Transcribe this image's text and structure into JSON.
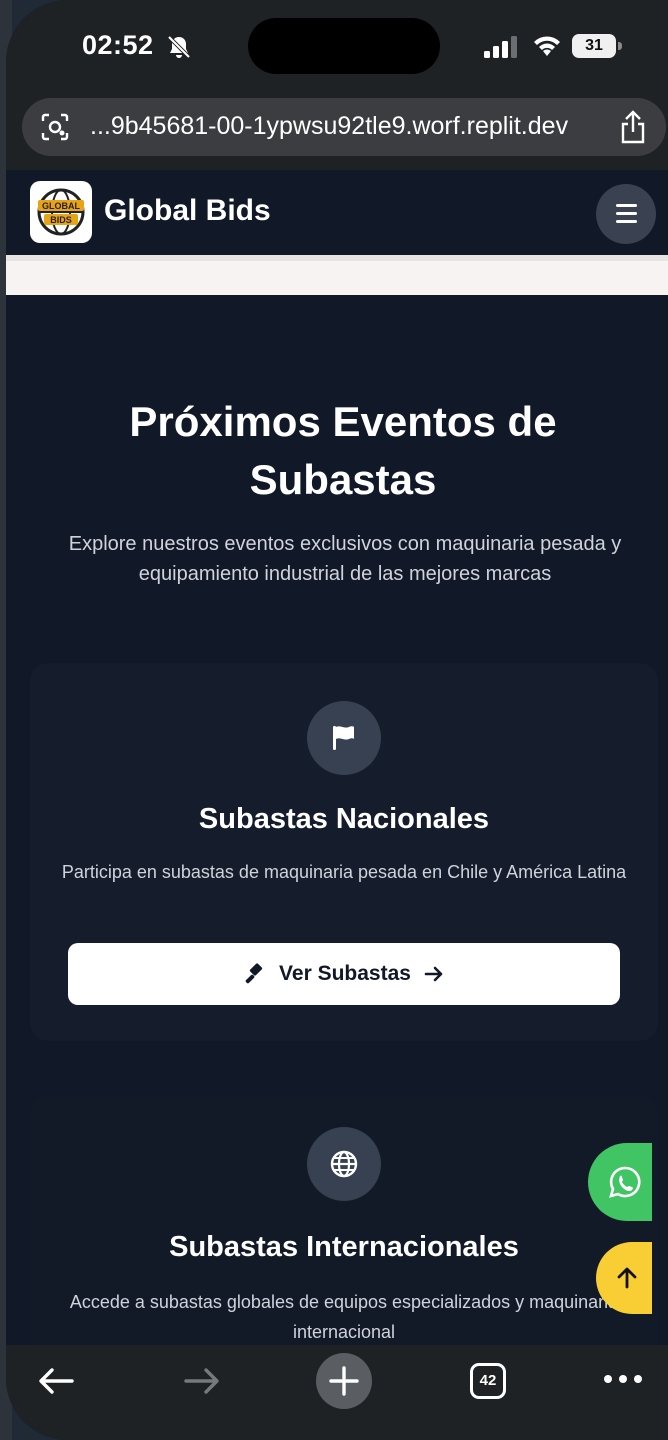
{
  "status_bar": {
    "time": "02:52",
    "battery": "31"
  },
  "browser": {
    "url": "...9b45681-00-1ypwsu92tle9.worf.replit.dev",
    "tab_count": "42"
  },
  "site": {
    "brand": "Global Bids",
    "logo_text_top": "GLOBAL",
    "logo_text_bottom": "BIDS"
  },
  "main": {
    "title": "Próximos Eventos de Subastas",
    "subtitle": "Explore nuestros eventos exclusivos con maquinaria pesada y equipamiento industrial de las mejores marcas",
    "cards": [
      {
        "title": "Subastas Nacionales",
        "description": "Participa en subastas de maquinaria pesada en Chile y América Latina",
        "button_label": "Ver Subastas",
        "icon": "flag-icon"
      },
      {
        "title": "Subastas Internacionales",
        "description": "Accede a subastas globales de equipos especializados y maquinaria internacional",
        "icon": "globe-icon"
      }
    ]
  },
  "colors": {
    "navbar": "#111827",
    "whatsapp": "#41c564",
    "scroll_top": "#f9ce35"
  }
}
